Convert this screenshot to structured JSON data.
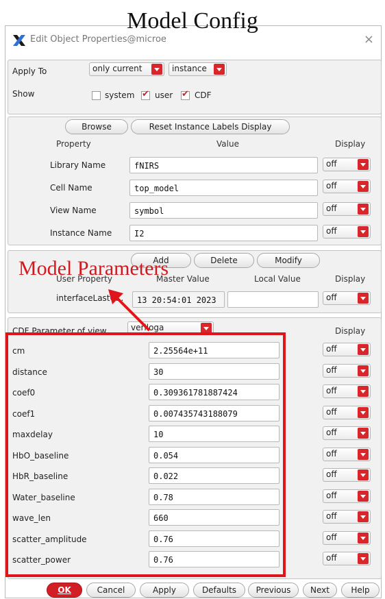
{
  "annotations": {
    "title": "Model Config",
    "params_label": "Model Parameters"
  },
  "window": {
    "title": "Edit Object Properties@microe",
    "close_glyph": "×",
    "icon": "x-logo-icon"
  },
  "apply_to": {
    "label": "Apply To",
    "scope": "only current",
    "target": "instance"
  },
  "show": {
    "label": "Show",
    "system": {
      "label": "system",
      "checked": false
    },
    "user": {
      "label": "user",
      "checked": true
    },
    "cdf": {
      "label": "CDF",
      "checked": true
    }
  },
  "instance_section": {
    "browse": "Browse",
    "reset": "Reset Instance Labels Display",
    "header_property": "Property",
    "header_value": "Value",
    "header_display": "Display",
    "rows": [
      {
        "label": "Library Name",
        "value": "fNIRS",
        "display": "off"
      },
      {
        "label": "Cell Name",
        "value": "top_model",
        "display": "off"
      },
      {
        "label": "View Name",
        "value": "symbol",
        "display": "off"
      },
      {
        "label": "Instance Name",
        "value": "I2",
        "display": "off"
      }
    ]
  },
  "user_props": {
    "add": "Add",
    "delete": "Delete",
    "modify": "Modify",
    "header_user_property": "User Property",
    "header_master_value": "Master Value",
    "header_local_value": "Local Value",
    "header_display": "Display",
    "row": {
      "label": "interfaceLastC...",
      "master_value": "13 20:54:01 2023",
      "local_value": "",
      "display": "off"
    }
  },
  "cdf": {
    "label": "CDF Parameter of view",
    "view": "veriloga",
    "header_display": "Display",
    "params": [
      {
        "label": "cm",
        "value": "2.25564e+11",
        "display": "off"
      },
      {
        "label": "distance",
        "value": "30",
        "display": "off"
      },
      {
        "label": "coef0",
        "value": "0.309361781887424",
        "display": "off"
      },
      {
        "label": "coef1",
        "value": "0.007435743188079",
        "display": "off"
      },
      {
        "label": "maxdelay",
        "value": "10",
        "display": "off"
      },
      {
        "label": "HbO_baseline",
        "value": "0.054",
        "display": "off"
      },
      {
        "label": "HbR_baseline",
        "value": "0.022",
        "display": "off"
      },
      {
        "label": "Water_baseline",
        "value": "0.78",
        "display": "off"
      },
      {
        "label": "wave_len",
        "value": "660",
        "display": "off"
      },
      {
        "label": "scatter_amplitude",
        "value": "0.76",
        "display": "off"
      },
      {
        "label": "scatter_power",
        "value": "0.76",
        "display": "off"
      }
    ]
  },
  "footer": {
    "ok": "OK",
    "cancel": "Cancel",
    "apply": "Apply",
    "defaults": "Defaults",
    "previous": "Previous",
    "next": "Next",
    "help": "Help"
  },
  "colors": {
    "accent_red": "#d21f26",
    "annotation_red": "#e0141b"
  }
}
